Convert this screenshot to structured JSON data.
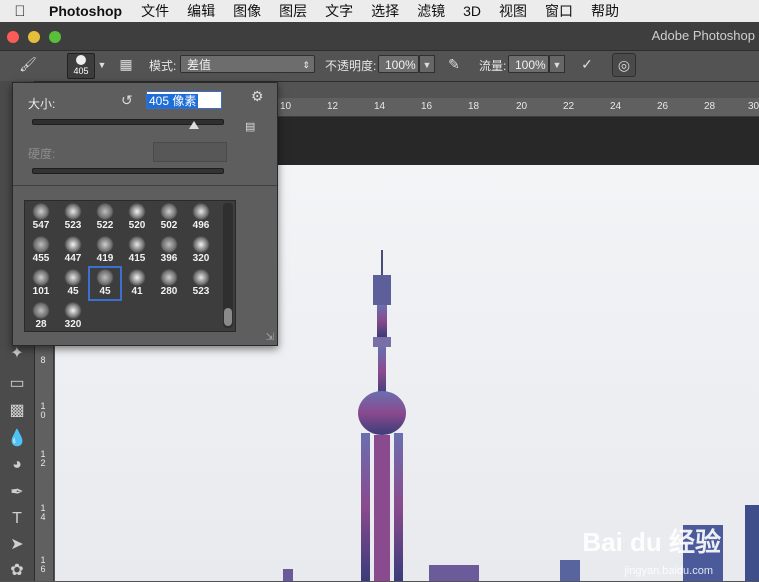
{
  "menubar": {
    "app": "Photoshop",
    "items": [
      "文件",
      "编辑",
      "图像",
      "图层",
      "文字",
      "选择",
      "滤镜",
      "3D",
      "视图",
      "窗口",
      "帮助"
    ]
  },
  "window": {
    "title": "Adobe Photoshop"
  },
  "options_bar": {
    "brush_size": "405",
    "mode_label": "模式:",
    "mode_value": "差值",
    "opacity_label": "不透明度:",
    "opacity_value": "100%",
    "flow_label": "流量:",
    "flow_value": "100%"
  },
  "brush_panel": {
    "size_label": "大小:",
    "size_value": "405 像素",
    "size_fraction": 0.85,
    "hardness_label": "硬度:",
    "presets": [
      {
        "n": "547"
      },
      {
        "n": "523"
      },
      {
        "n": "522"
      },
      {
        "n": "520"
      },
      {
        "n": "502"
      },
      {
        "n": "496"
      },
      {
        "n": "455"
      },
      {
        "n": "447"
      },
      {
        "n": "419"
      },
      {
        "n": "415"
      },
      {
        "n": "396"
      },
      {
        "n": "320"
      },
      {
        "n": "101"
      },
      {
        "n": "45"
      },
      {
        "n": "45",
        "selected": true
      },
      {
        "n": "41"
      },
      {
        "n": "280"
      },
      {
        "n": "523"
      },
      {
        "n": "28"
      },
      {
        "n": "320"
      }
    ]
  },
  "rulers": {
    "top": [
      "10",
      "12",
      "14",
      "16",
      "18",
      "20",
      "22",
      "24",
      "26",
      "28",
      "30"
    ],
    "left": [
      "8",
      "1\n0",
      "1\n2",
      "1\n4",
      "1\n6"
    ]
  },
  "watermark": {
    "main": "Bai du 经验",
    "sub": "jingyan.baidu.com"
  },
  "colors": {
    "selection": "#3b6fd0",
    "panel": "#5e5e5e",
    "canvas": "#eef0f3"
  }
}
